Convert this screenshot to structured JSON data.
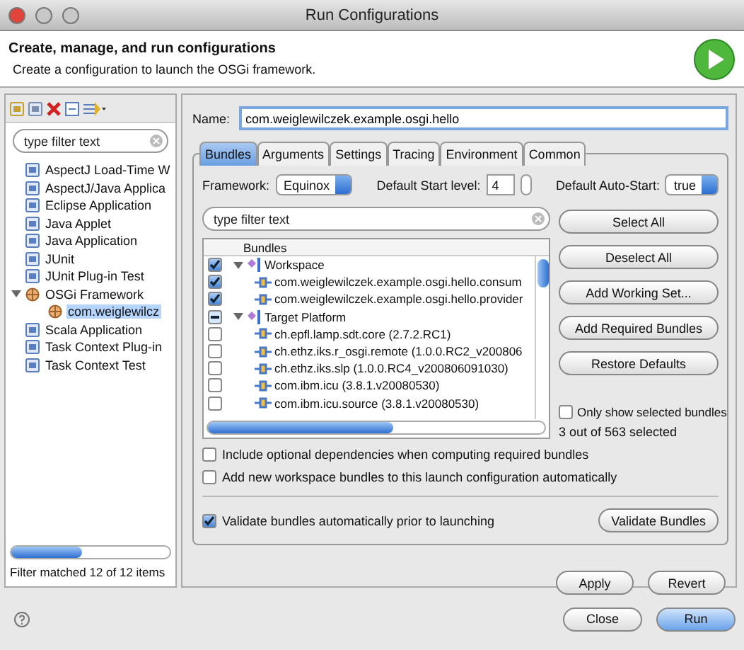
{
  "window": {
    "title": "Run Configurations"
  },
  "header": {
    "title": "Create, manage, and run configurations",
    "subtitle": "Create a configuration to launch the OSGi framework."
  },
  "sidebar": {
    "filter": {
      "placeholder": "type filter text"
    },
    "items": [
      {
        "label": "AspectJ Load-Time W",
        "selected": false
      },
      {
        "label": "AspectJ/Java Applica",
        "selected": false
      },
      {
        "label": "Eclipse Application",
        "selected": false
      },
      {
        "label": "Java Applet",
        "selected": false
      },
      {
        "label": "Java Application",
        "selected": false
      },
      {
        "label": "JUnit",
        "selected": false
      },
      {
        "label": "JUnit Plug-in Test",
        "selected": false
      },
      {
        "label": "OSGi Framework",
        "selected": false,
        "expanded": true,
        "children": [
          {
            "label": "com.weiglewilcz",
            "selected": true
          }
        ]
      },
      {
        "label": "Scala Application",
        "selected": false
      },
      {
        "label": "Task Context Plug-in",
        "selected": false
      },
      {
        "label": "Task Context Test",
        "selected": false
      }
    ],
    "status": "Filter matched 12 of 12 items"
  },
  "name_field": {
    "label": "Name:",
    "value": "com.weiglewilczek.example.osgi.hello"
  },
  "tabs": [
    {
      "label": "Bundles",
      "selected": true
    },
    {
      "label": "Arguments",
      "selected": false
    },
    {
      "label": "Settings",
      "selected": false
    },
    {
      "label": "Tracing",
      "selected": false
    },
    {
      "label": "Environment",
      "selected": false
    },
    {
      "label": "Common",
      "selected": false
    }
  ],
  "settings": {
    "framework_label": "Framework:",
    "framework": "Equinox",
    "start_level_label": "Default Start level:",
    "start_level": "4",
    "auto_start_label": "Default Auto-Start:",
    "auto_start": "true"
  },
  "bundles": {
    "filter": {
      "placeholder": "type filter text"
    },
    "column": "Bundles",
    "groups": [
      {
        "label": "Workspace",
        "checked": true,
        "mixed": false,
        "expanded": true,
        "children": [
          {
            "label": "com.weiglewilczek.example.osgi.hello.consum",
            "checked": true
          },
          {
            "label": "com.weiglewilczek.example.osgi.hello.provider",
            "checked": true
          }
        ]
      },
      {
        "label": "Target Platform",
        "checked": false,
        "mixed": true,
        "expanded": true,
        "children": [
          {
            "label": "ch.epfl.lamp.sdt.core (2.7.2.RC1)",
            "checked": false
          },
          {
            "label": "ch.ethz.iks.r_osgi.remote (1.0.0.RC2_v200806",
            "checked": false
          },
          {
            "label": "ch.ethz.iks.slp (1.0.0.RC4_v200806091030)",
            "checked": false
          },
          {
            "label": "com.ibm.icu (3.8.1.v20080530)",
            "checked": false
          },
          {
            "label": "com.ibm.icu.source (3.8.1.v20080530)",
            "checked": false
          }
        ]
      }
    ]
  },
  "bundle_buttons": [
    "Select All",
    "Deselect All",
    "Add Working Set...",
    "Add Required Bundles",
    "Restore Defaults"
  ],
  "only_selected": {
    "label": "Only show selected bundles",
    "checked": false
  },
  "selection_count": "3 out of 563 selected",
  "options": [
    {
      "label": "Include optional dependencies when computing required bundles",
      "checked": false
    },
    {
      "label": "Add new workspace bundles to this launch configuration automatically",
      "checked": false
    }
  ],
  "validate": {
    "label": "Validate bundles automatically prior to launching",
    "checked": true,
    "button": "Validate Bundles"
  },
  "config_buttons": [
    "Apply",
    "Revert"
  ],
  "footer_buttons": [
    {
      "label": "Close",
      "default": false
    },
    {
      "label": "Run",
      "default": true
    }
  ]
}
